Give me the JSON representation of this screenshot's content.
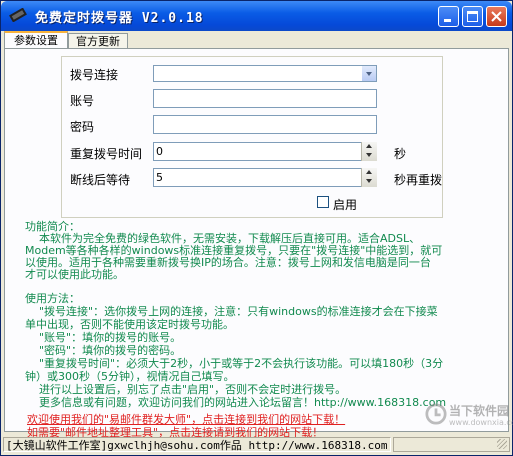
{
  "window": {
    "title": "免费定时拨号器 V2.0.18"
  },
  "tabs": [
    {
      "label": "参数设置",
      "active": true
    },
    {
      "label": "官方更新",
      "active": false
    }
  ],
  "form": {
    "connection_label": "拨号连接",
    "connection_value": "",
    "account_label": "账号",
    "account_value": "",
    "password_label": "密码",
    "password_value": "",
    "redial_label": "重复拨号时间",
    "redial_value": "0",
    "redial_unit": "秒",
    "wait_label": "断线后等待",
    "wait_value": "5",
    "wait_unit": "秒再重拨",
    "enable_label": "启用",
    "enable_checked": false
  },
  "description": {
    "intro_title": "功能简介：",
    "intro_lines": [
      "    本软件为完全免费的绿色软件，无需安装，下载解压后直接可用。适合ADSL、",
      "Modem等各种各样的windows标准连接重复拨号，只要在\"拨号连接\"中能选到，就可",
      "以使用。适用于各种需要重新拨号换IP的场合。注意：拨号上网和发信电脑是同一台",
      "才可以使用此功能。"
    ],
    "usage_title": "使用方法：",
    "usage_lines": [
      "    \"拨号连接\"：选你拨号上网的连接，注意：只有windows的标准连接才会在下接菜",
      "单中出现，否则不能使用该定时拨号功能。",
      "    \"账号\"：填你的拨号的账号。",
      "    \"密码\"：填你的拨号的密码。",
      "    \"重复拨号时间\"：必须大于2秒，小于或等于2不会执行该功能。可以填180秒（3分",
      "钟）或300秒（5分钟），视情况自己填写。",
      "    进行以上设置后，别忘了点击\"启用\"，否则不会定时进行拨号。",
      "    更多信息或有问题，欢迎访问我们的网站进入论坛留言！http://www.168318.com"
    ]
  },
  "links": {
    "promo1": "欢迎使用我们的\"易邮件群发大师\"，点击连接到我们的网站下载！",
    "promo2": "如需要\"邮件地址整理工具\"，点击连接请到我们的网站下载！"
  },
  "statusbar": {
    "text": "[大镜山软件工作室]gxwclhjh@sohu.com作品 http://www.168318.com"
  },
  "watermark": {
    "text": "当下软件园",
    "sub": "www.downxia.com"
  },
  "colors": {
    "titlebar": "#0a5ce6",
    "desc_text": "#128a4f",
    "link_text": "#e02020",
    "close_btn": "#c63a1b"
  },
  "icons": [
    "app-icon",
    "minimize-icon",
    "maximize-icon",
    "close-icon",
    "dropdown-arrow-icon",
    "spin-up-icon",
    "spin-down-icon",
    "resize-grip-icon"
  ]
}
